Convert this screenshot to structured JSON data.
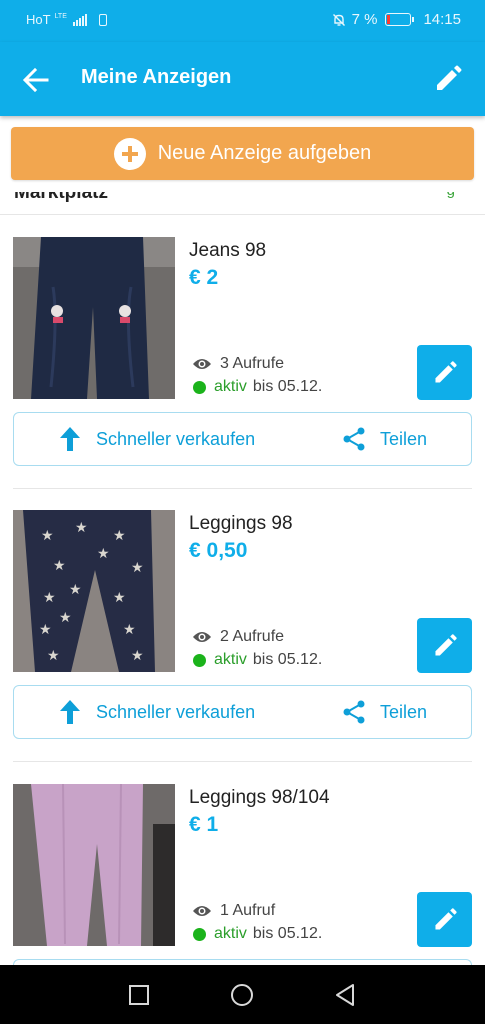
{
  "status_bar": {
    "carrier": "HoT",
    "lte": "LTE",
    "battery_percent": "7 %",
    "battery_level": 0.07,
    "time": "14:15",
    "colors": {
      "bar": "#0faee9",
      "battery_low": "#ff3b30"
    }
  },
  "app_bar": {
    "title": "Meine Anzeigen",
    "back_icon": "arrow-left-icon",
    "edit_icon": "pencil-icon"
  },
  "cta": {
    "label": "Neue Anzeige aufgeben",
    "icon": "plus-circle-icon",
    "color": "#f2a64f"
  },
  "section": {
    "title": "Marktplatz",
    "link": "g"
  },
  "listings": [
    {
      "title": "Jeans 98",
      "price": "€ 2",
      "views": "3 Aufrufe",
      "status": "aktiv",
      "until": "bis 05.12.",
      "sell_label": "Schneller verkaufen",
      "share_label": "Teilen"
    },
    {
      "title": "Leggings 98",
      "price": "€ 0,50",
      "views": "2 Aufrufe",
      "status": "aktiv",
      "until": "bis 05.12.",
      "sell_label": "Schneller verkaufen",
      "share_label": "Teilen"
    },
    {
      "title": "Leggings 98/104",
      "price": "€ 1",
      "views": "1 Aufruf",
      "status": "aktiv",
      "until": "bis 05.12."
    }
  ],
  "colors": {
    "accent": "#0faee9",
    "active": "#1bb31b"
  },
  "nav": {
    "square_icon": "recent-apps-icon",
    "home_icon": "home-circle-icon",
    "back_icon": "back-triangle-icon"
  }
}
